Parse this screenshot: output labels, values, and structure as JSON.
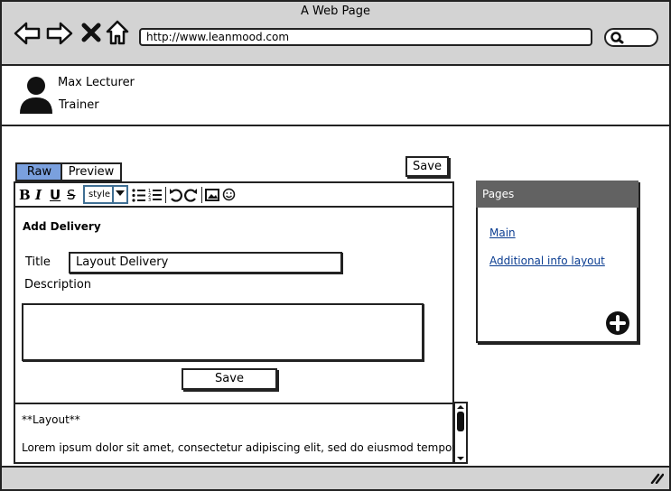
{
  "window": {
    "title": "A Web Page"
  },
  "browser": {
    "url": "http://www.leanmood.com"
  },
  "user": {
    "name": "Max Lecturer",
    "role": "Trainer"
  },
  "editor": {
    "tabs": [
      {
        "label": "Raw",
        "active": true
      },
      {
        "label": "Preview",
        "active": false
      }
    ],
    "save_label": "Save",
    "toolbar": {
      "style_label": "style"
    },
    "form": {
      "heading": "Add Delivery",
      "title_label": "Title",
      "title_value": "Layout Delivery",
      "description_label": "Description",
      "save_label": "Save"
    },
    "preview": {
      "heading": "**Layout**",
      "body": "Lorem ipsum dolor sit amet, consectetur adipiscing elit, sed do eiusmod tempor incididunt ut labore et dolore magna aliqua. Ut enim ad minim veniam, quis"
    }
  },
  "pages": {
    "heading": "Pages",
    "links": [
      "Main",
      "Additional info layout"
    ]
  },
  "colors": {
    "active_tab": "#7aa0de",
    "panel_header": "#626262",
    "link": "#0b3d91",
    "chrome": "#d3d3d3"
  }
}
